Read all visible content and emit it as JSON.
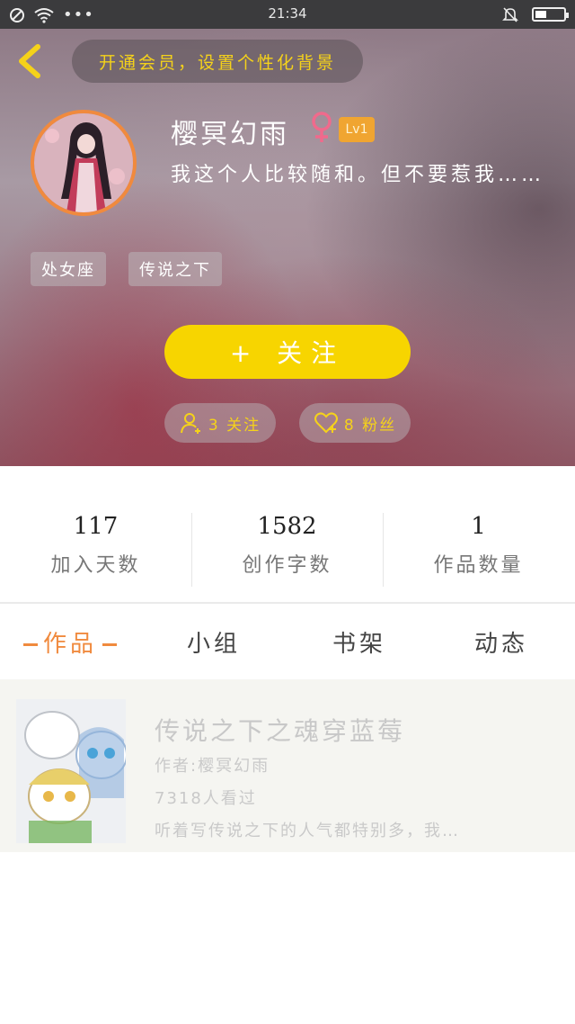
{
  "status_bar": {
    "time": "21:34",
    "battery_level": 0.4
  },
  "header": {
    "vip_banner": "开通会员，设置个性化背景",
    "username": "樱冥幻雨",
    "gender_symbol": "♀",
    "level": "Lv1",
    "bio": "我这个人比较随和。但不要惹我……",
    "tags": [
      "处女座",
      "传说之下"
    ],
    "follow_button": "+ 关注",
    "following": "3 关注",
    "followers": "8 粉丝",
    "colors": {
      "accent": "#f7d500",
      "avatar_border": "#f08a3e",
      "level_badge": "#f0a531"
    }
  },
  "stats": [
    {
      "value": "117",
      "label": "加入天数"
    },
    {
      "value": "1582",
      "label": "创作字数"
    },
    {
      "value": "1",
      "label": "作品数量"
    }
  ],
  "tabs": [
    {
      "label": "作品",
      "active": true
    },
    {
      "label": "小组",
      "active": false
    },
    {
      "label": "书架",
      "active": false
    },
    {
      "label": "动态",
      "active": false
    }
  ],
  "works": [
    {
      "title": "传说之下之魂穿蓝莓",
      "author": "作者:樱冥幻雨",
      "views": "7318人看过",
      "summary": "听着写传说之下的人气都特别多，我…"
    }
  ],
  "icons": [
    "back-arrow-icon",
    "female-icon",
    "user-follow-icon",
    "heart-icon",
    "no-disturb-icon",
    "wifi-icon",
    "more-dots-icon",
    "bell-muted-icon",
    "battery-icon"
  ]
}
